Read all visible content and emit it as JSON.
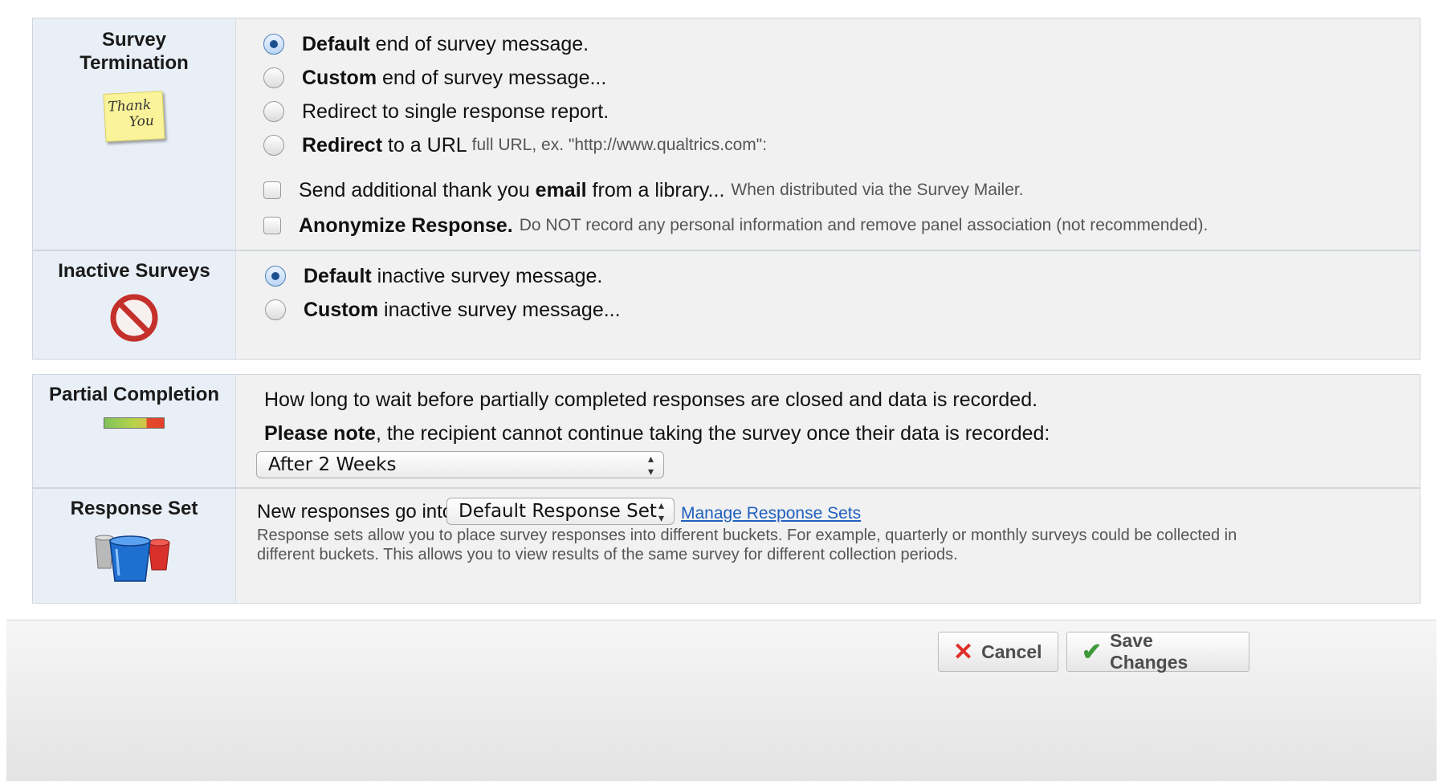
{
  "survey_termination": {
    "title": "Survey Termination",
    "icon_text_1": "Thank",
    "icon_text_2": "You",
    "options": [
      {
        "bold": "Default",
        "text": " end of survey message.",
        "selected": true
      },
      {
        "bold": "Custom",
        "text": " end of survey message...",
        "selected": false
      },
      {
        "bold": "",
        "text": "Redirect to single response report.",
        "selected": false
      },
      {
        "bold": "Redirect",
        "text": " to a URL ",
        "hint": "full URL, ex. \"http://www.qualtrics.com\":",
        "selected": false
      }
    ],
    "email_check": {
      "pre": "Send additional thank you ",
      "bold": "email",
      "post": " from a library...",
      "hint": "When distributed via the Survey Mailer.",
      "checked": false
    },
    "anon_check": {
      "bold": "Anonymize Response.",
      "hint": "Do NOT record any personal information and remove panel association (not recommended).",
      "checked": false
    }
  },
  "inactive_surveys": {
    "title": "Inactive Surveys",
    "options": [
      {
        "bold": "Default",
        "text": " inactive survey message.",
        "selected": true
      },
      {
        "bold": "Custom",
        "text": " inactive survey message...",
        "selected": false
      }
    ]
  },
  "partial_completion": {
    "title": "Partial Completion",
    "description": "How long to wait before partially completed responses are closed and data is recorded.",
    "note_bold": "Please note",
    "note_text": ", the recipient cannot continue taking the survey once their data is recorded:",
    "selected": "After 2 Weeks"
  },
  "response_set": {
    "title": "Response Set",
    "label": "New responses go into:",
    "selected": "Default Response Set",
    "manage_link": "Manage Response Sets",
    "help_line_1": "Response sets allow you to place survey responses into different buckets. For example, quarterly or monthly surveys could be collected in",
    "help_line_2": "different buckets. This allows you to view results of the same survey for different collection periods."
  },
  "footer": {
    "cancel_label": "Cancel",
    "save_label": "Save Changes"
  },
  "colors": {
    "accent": "#1d4f8f",
    "link": "#1f5fc0",
    "cancel_icon": "#e0302b",
    "save_icon": "#3f9a3a"
  },
  "icons": {
    "thank_you": "thank-you-note-icon",
    "inactive": "no-entry-icon",
    "partial": "progress-bar-icon",
    "response_set": "buckets-icon",
    "cancel": "x-icon",
    "save": "checkmark-icon",
    "select_arrows": "updown-arrows-icon"
  }
}
